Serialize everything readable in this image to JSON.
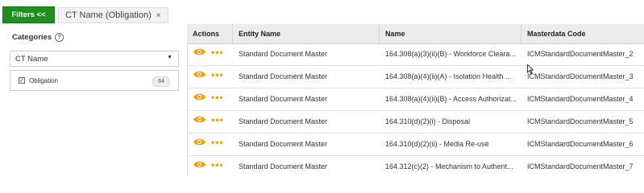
{
  "header": {
    "filters_button": "Filters <<",
    "active_filter_chip": "CT Name (Obligation)",
    "chip_close": "×"
  },
  "sidebar": {
    "title": "Categories",
    "help_glyph": "?",
    "selected_category": "CT Name",
    "options": [
      {
        "label": "Obligation",
        "count": "64",
        "checked": true
      }
    ]
  },
  "table": {
    "columns": [
      "Actions",
      "Entity Name",
      "Name",
      "Masterdata Code"
    ],
    "rows": [
      {
        "entity": "Standard Document Master",
        "name": "164.308(a)(3)(ii)(B) - Workforce Cleara...",
        "code": "ICMStandardDocumentMaster_2"
      },
      {
        "entity": "Standard Document Master",
        "name": "164.308(a)(4)(ii)(A) - Isolation Health ...",
        "code": "ICMStandardDocumentMaster_3"
      },
      {
        "entity": "Standard Document Master",
        "name": "164.308(a)(4)(ii)(B) - Access Authorizat...",
        "code": "ICMStandardDocumentMaster_4"
      },
      {
        "entity": "Standard Document Master",
        "name": "164.310(d)(2)(i) - Disposal",
        "code": "ICMStandardDocumentMaster_5"
      },
      {
        "entity": "Standard Document Master",
        "name": "164.310(d)(2)(ii) - Media Re-use",
        "code": "ICMStandardDocumentMaster_6"
      },
      {
        "entity": "Standard Document Master",
        "name": "164.312(c)(2) - Mechanism to Authent...",
        "code": "ICMStandardDocumentMaster_7"
      }
    ],
    "row_actions": {
      "view_icon": "eye-icon",
      "more_icon": "more-dots-icon",
      "more_glyph": "•••"
    }
  },
  "colors": {
    "filters_green": "#1f8f1f",
    "eye_orange": "#f0a000",
    "header_bg": "#ececec"
  }
}
